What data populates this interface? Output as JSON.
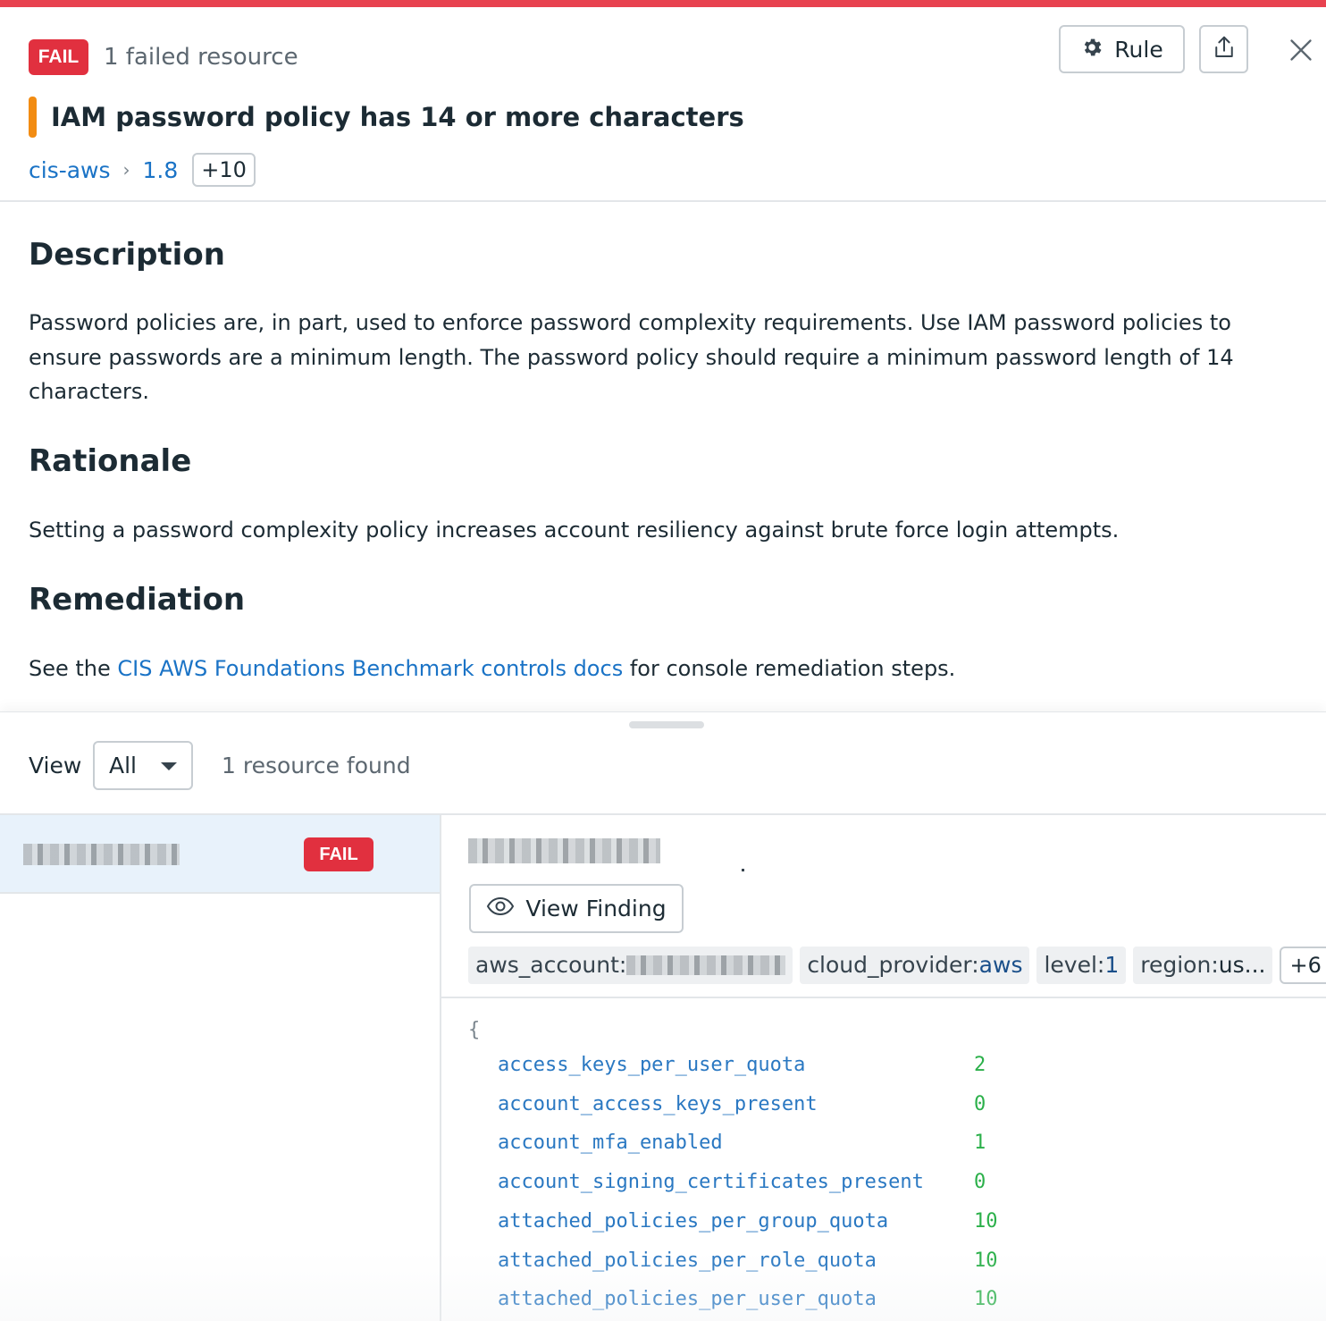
{
  "header": {
    "status_badge": "FAIL",
    "failed_count_text": "1 failed resource",
    "rule_button_label": "Rule",
    "title": "IAM password policy has 14 or more characters",
    "severity_color": "#f28c13",
    "breadcrumb": {
      "framework": "cis-aws",
      "control": "1.8",
      "more": "+10"
    }
  },
  "description": {
    "heading": "Description",
    "text": "Password policies are, in part, used to enforce password complexity requirements. Use IAM password policies to ensure passwords are a minimum length. The password policy should require a minimum password length of 14 characters."
  },
  "rationale": {
    "heading": "Rationale",
    "text": "Setting a password complexity policy increases account resiliency against brute force login attempts."
  },
  "remediation": {
    "heading": "Remediation",
    "prefix": "See the ",
    "link_text": "CIS AWS Foundations Benchmark controls docs",
    "suffix": " for console remediation steps."
  },
  "resources": {
    "view_label": "View",
    "view_selected": "All",
    "found_text": "1 resource found",
    "list": [
      {
        "status": "FAIL"
      }
    ],
    "detail": {
      "view_finding_label": "View Finding",
      "tags": [
        {
          "key": "aws_account:",
          "value": ""
        },
        {
          "key": "cloud_provider:",
          "value": "aws"
        },
        {
          "key": "level:",
          "value": "1"
        },
        {
          "key": "region:",
          "value": "us..."
        }
      ],
      "more_tags": "+6",
      "json_open": "{",
      "json": [
        {
          "key": "access_keys_per_user_quota",
          "value": "2"
        },
        {
          "key": "account_access_keys_present",
          "value": "0"
        },
        {
          "key": "account_mfa_enabled",
          "value": "1"
        },
        {
          "key": "account_signing_certificates_present",
          "value": "0"
        },
        {
          "key": "attached_policies_per_group_quota",
          "value": "10"
        },
        {
          "key": "attached_policies_per_role_quota",
          "value": "10"
        },
        {
          "key": "attached_policies_per_user_quota",
          "value": "10"
        }
      ]
    }
  },
  "colors": {
    "accent_top": "#e8424f",
    "fail": "#e1303f",
    "link": "#1a73c6",
    "json_key": "#2a78c2",
    "json_value": "#2bb04a",
    "selected_row": "#e8f2fb"
  }
}
